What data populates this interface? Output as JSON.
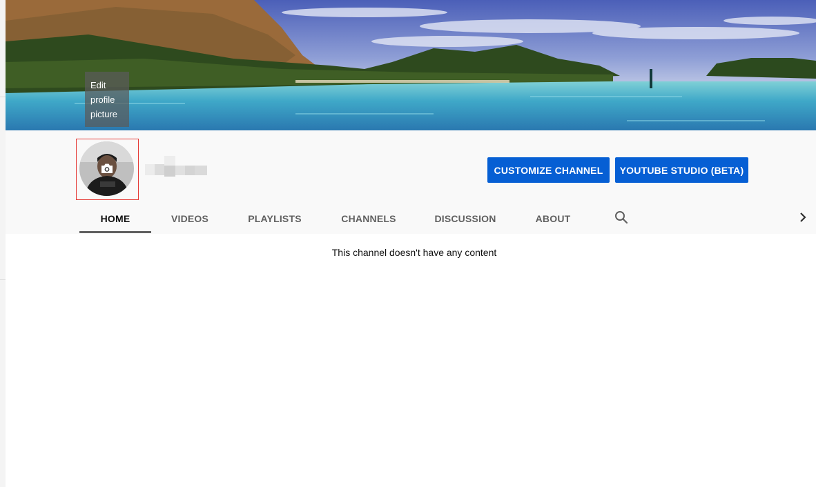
{
  "tooltip": {
    "line1": "Edit",
    "line2": "profile",
    "line3": "picture"
  },
  "buttons": {
    "customize_label": "CUSTOMIZE CHANNEL",
    "studio_label": "YOUTUBE STUDIO (BETA)"
  },
  "tabs": [
    {
      "label": "HOME",
      "active": true
    },
    {
      "label": "VIDEOS"
    },
    {
      "label": "PLAYLISTS"
    },
    {
      "label": "CHANNELS"
    },
    {
      "label": "DISCUSSION"
    },
    {
      "label": "ABOUT"
    }
  ],
  "icons": {
    "search": "search-icon",
    "next": "chevron-right-icon",
    "camera": "camera-icon"
  },
  "content": {
    "empty_message": "This channel doesn't have any content"
  },
  "colors": {
    "button_blue": "#065fd4",
    "header_bg": "#f9f9f9",
    "avatar_frame": "#e53935"
  }
}
